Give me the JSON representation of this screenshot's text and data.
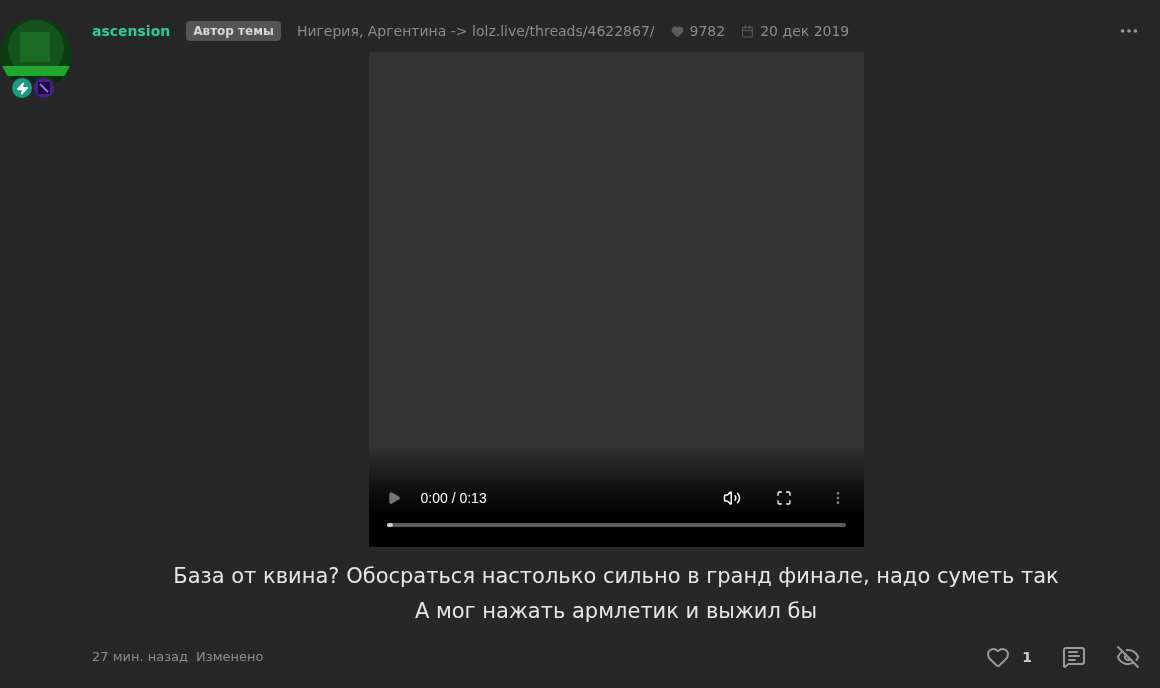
{
  "post": {
    "author": "ascension",
    "author_badge": "Автор темы",
    "subtitle": "Нигерия, Аргентина -> lolz.live/threads/4622867/",
    "likes_total": "9782",
    "date": "20 дек 2019",
    "video": {
      "time": "0:00 / 0:13",
      "progress": {
        "level": 0.015
      }
    },
    "lines": [
      "База от квина? Обосраться настолько сильно в гранд финале, надо суметь так",
      "А мог нажать армлетик и выжил бы"
    ],
    "time_ago": "27 мин. назад",
    "edited": "Изменено",
    "likes": "1"
  }
}
